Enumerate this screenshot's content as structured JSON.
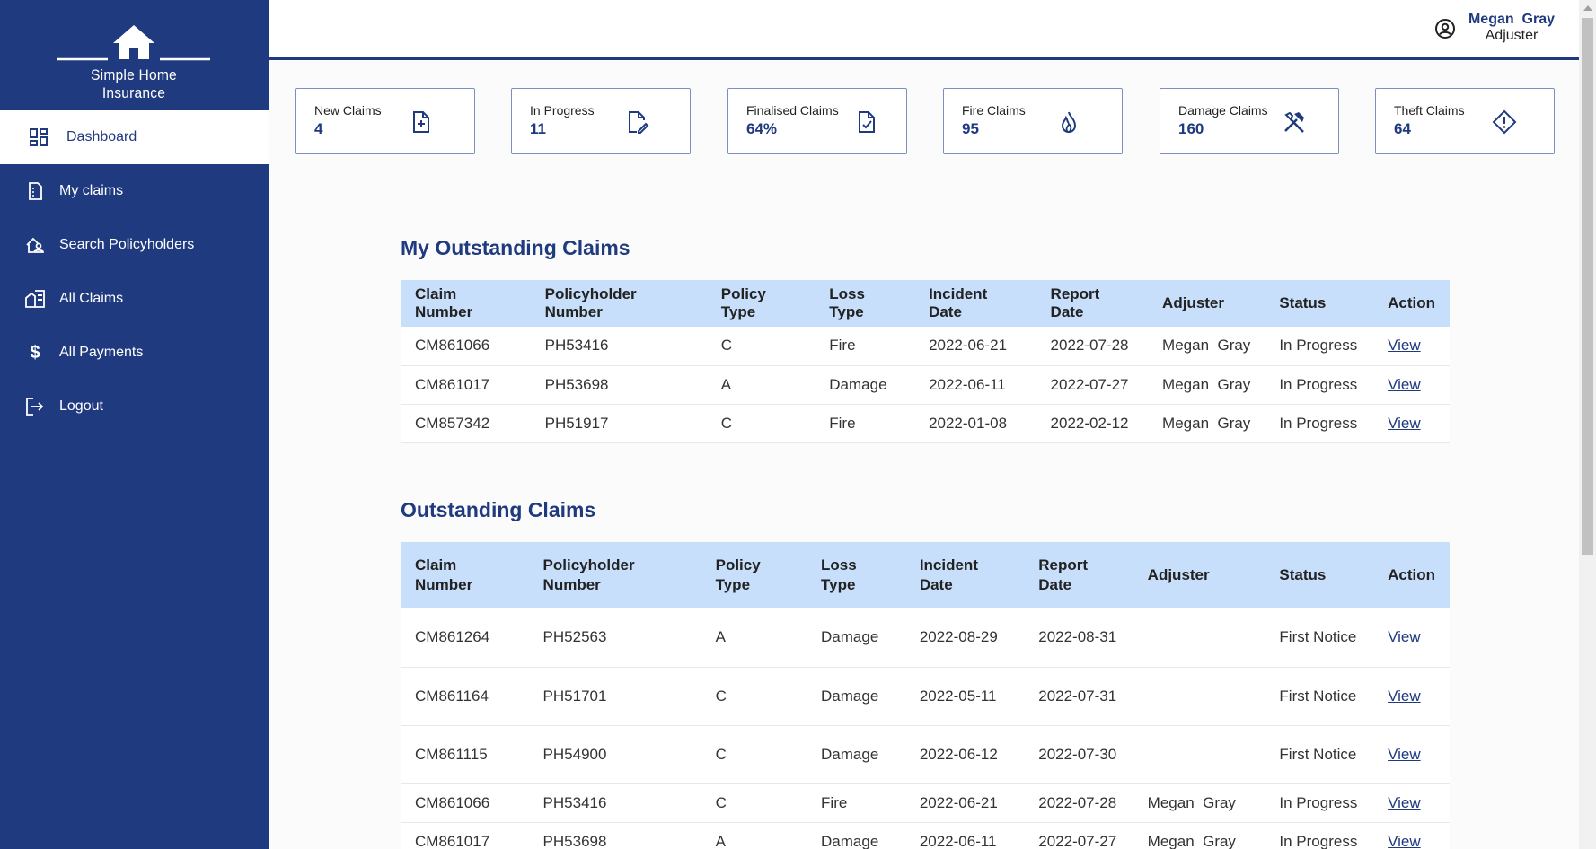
{
  "app": {
    "logo_text": "Simple Home Insurance"
  },
  "sidebar": {
    "items": [
      {
        "label": "Dashboard",
        "icon": "dashboard-icon",
        "active": true
      },
      {
        "label": "My claims",
        "icon": "claims-icon"
      },
      {
        "label": "Search Policyholders",
        "icon": "home-person-icon"
      },
      {
        "label": "All Claims",
        "icon": "buildings-icon"
      },
      {
        "label": "All Payments",
        "icon": "dollar-icon"
      },
      {
        "label": "Logout",
        "icon": "logout-icon"
      }
    ]
  },
  "header": {
    "user_name": "Megan  Gray",
    "user_role": "Adjuster",
    "user_icon": "user-circle-icon"
  },
  "stats": [
    {
      "label": "New Claims",
      "value": "4",
      "icon": "file-plus-icon"
    },
    {
      "label": "In Progress",
      "value": "11",
      "icon": "file-edit-icon"
    },
    {
      "label": "Finalised Claims",
      "value": "64%",
      "icon": "file-check-icon"
    },
    {
      "label": "Fire Claims",
      "value": "95",
      "icon": "fire-icon"
    },
    {
      "label": "Damage Claims",
      "value": "160",
      "icon": "tools-icon"
    },
    {
      "label": "Theft Claims",
      "value": "64",
      "icon": "warning-diamond-icon"
    }
  ],
  "my_outstanding": {
    "title": "My Outstanding Claims",
    "columns": [
      "Claim Number",
      "Policyholder Number",
      "Policy Type",
      "Loss Type",
      "Incident Date",
      "Report Date",
      "Adjuster",
      "Status",
      "Action"
    ],
    "rows": [
      [
        "CM861066",
        "PH53416",
        "C",
        "Fire",
        "2022-06-21",
        "2022-07-28",
        "Megan  Gray",
        "In Progress",
        "View"
      ],
      [
        "CM861017",
        "PH53698",
        "A",
        "Damage",
        "2022-06-11",
        "2022-07-27",
        "Megan  Gray",
        "In Progress",
        "View"
      ],
      [
        "CM857342",
        "PH51917",
        "C",
        "Fire",
        "2022-01-08",
        "2022-02-12",
        "Megan  Gray",
        "In Progress",
        "View"
      ]
    ]
  },
  "outstanding": {
    "title": "Outstanding Claims",
    "columns": [
      "Claim Number",
      "Policyholder Number",
      "Policy Type",
      "Loss Type",
      "Incident Date",
      "Report Date",
      "Adjuster",
      "Status",
      "Action"
    ],
    "rows": [
      [
        "CM861264",
        "PH52563",
        "A",
        "Damage",
        "2022-08-29",
        "2022-08-31",
        "",
        "First Notice",
        "View"
      ],
      [
        "CM861164",
        "PH51701",
        "C",
        "Damage",
        "2022-05-11",
        "2022-07-31",
        "",
        "First Notice",
        "View"
      ],
      [
        "CM861115",
        "PH54900",
        "C",
        "Damage",
        "2022-06-12",
        "2022-07-30",
        "",
        "First Notice",
        "View"
      ],
      [
        "CM861066",
        "PH53416",
        "C",
        "Fire",
        "2022-06-21",
        "2022-07-28",
        "Megan  Gray",
        "In Progress",
        "View"
      ],
      [
        "CM861017",
        "PH53698",
        "A",
        "Damage",
        "2022-06-11",
        "2022-07-27",
        "Megan  Gray",
        "In Progress",
        "View"
      ]
    ]
  },
  "colors": {
    "primary": "#1f3a7f",
    "header_row": "#c7dffb",
    "background": "#fbfbfb"
  }
}
